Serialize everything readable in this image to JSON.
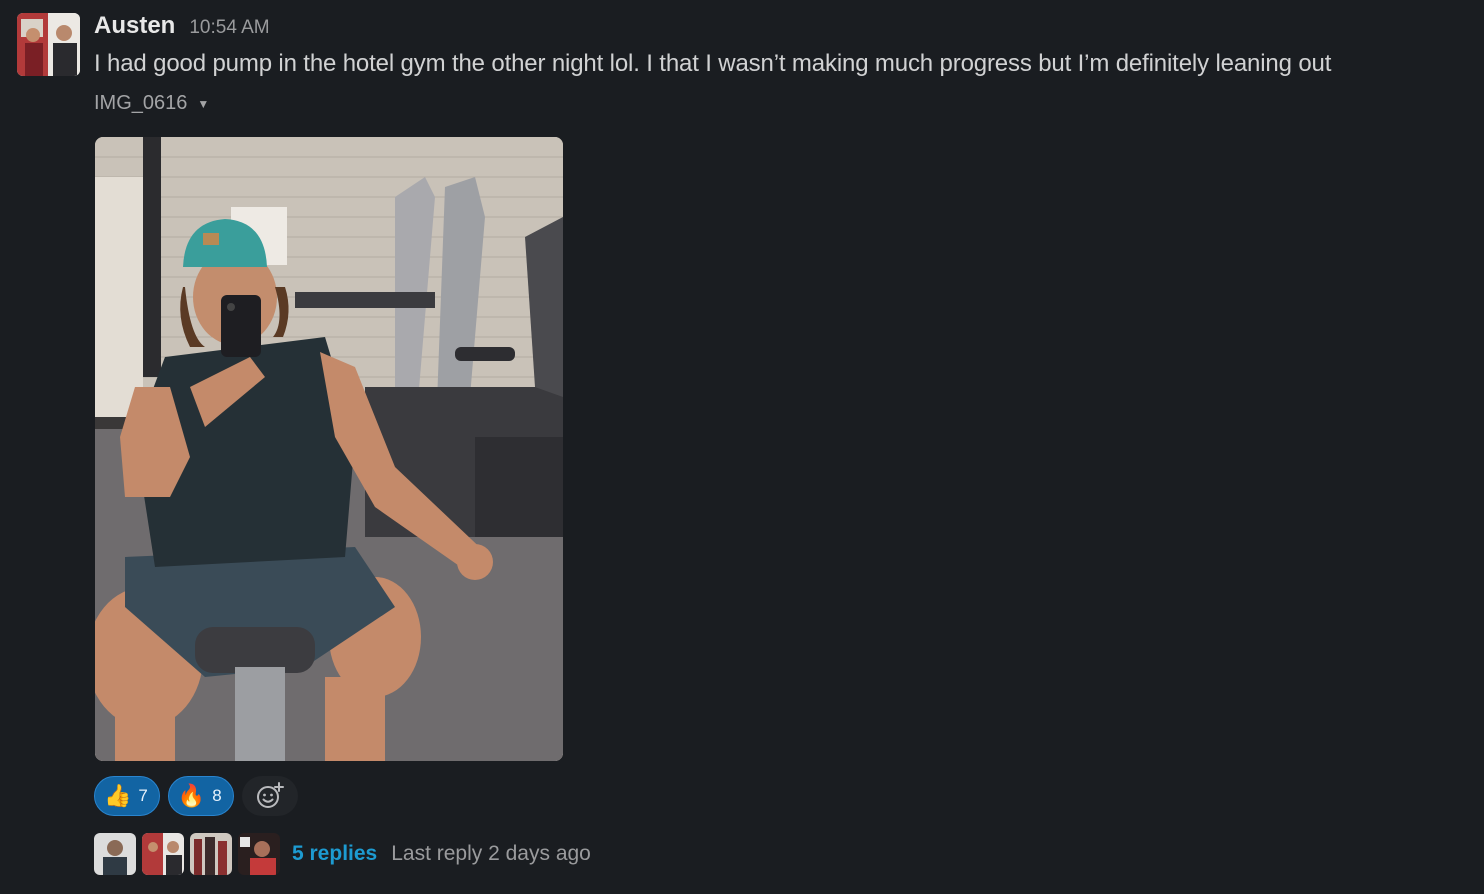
{
  "message": {
    "author": "Austen",
    "timestamp": "10:54 AM",
    "text": "I had good pump in the hotel gym the other night lol. I that I wasn’t making much progress but I’m definitely leaning out",
    "attachment": {
      "file_name": "IMG_0616",
      "caret_icon": "chevron-down-icon"
    }
  },
  "reactions": [
    {
      "emoji": "👍",
      "icon": "thumbs-up-icon",
      "count": "7"
    },
    {
      "emoji": "🔥",
      "icon": "fire-icon",
      "count": "8"
    }
  ],
  "add_reaction_icon": "add-emoji-icon",
  "thread": {
    "replies_label": "5 replies",
    "last_reply_label": "Last reply 2 days ago"
  },
  "colors": {
    "background": "#1a1d21",
    "reaction_active": "#1264a3",
    "link": "#1d9bd1",
    "muted_text": "#9a9b9d"
  }
}
